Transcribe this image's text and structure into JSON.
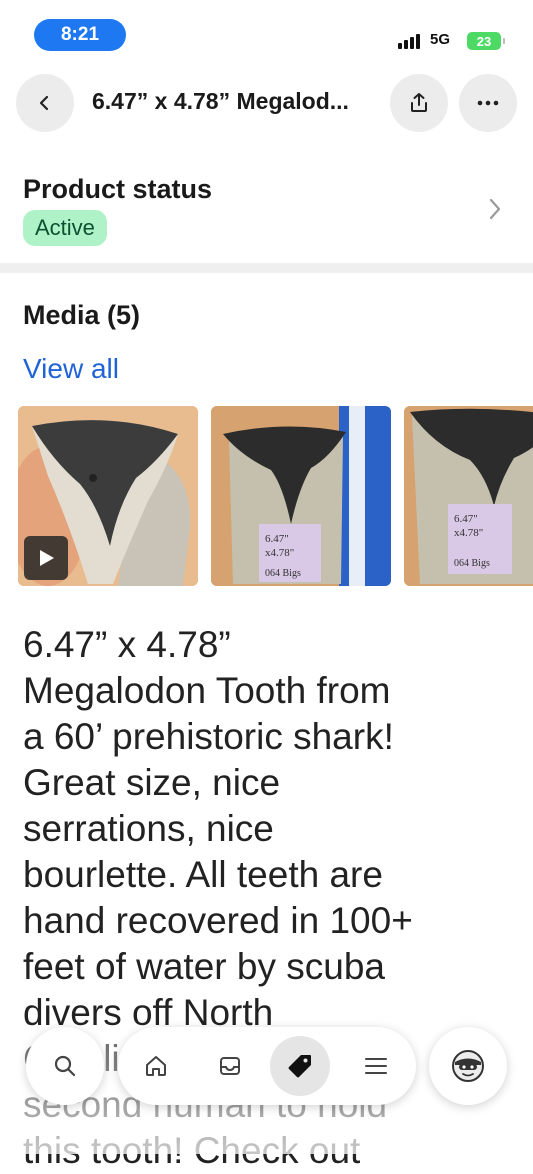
{
  "status_bar": {
    "time": "8:21",
    "network": "5G",
    "battery": "23"
  },
  "header": {
    "title": "6.47” x 4.78” Megalod..."
  },
  "product_status": {
    "heading": "Product status",
    "badge": "Active",
    "badge_color": "#aff2c7"
  },
  "media": {
    "heading": "Media (5)",
    "view_all": "View all"
  },
  "description": "6.47” x 4.78”\nMegalodon Tooth from\na 60’ prehistoric shark!\nGreat size, nice\nserrations, nice\nbourlette. All teeth are\nhand recovered in 100+\nfeet of water by scuba\ndivers off North\nCarolina. You’ll be the\nsecond human to hold\nthis tooth! Check out",
  "icons": {
    "back": "chevron-left-icon",
    "share": "share-icon",
    "more": "more-icon",
    "chevron": "chevron-right-icon",
    "search": "search-icon",
    "home": "home-icon",
    "orders": "inbox-icon",
    "products": "tag-icon",
    "menu": "menu-icon",
    "avatar": "avatar-icon"
  },
  "colors": {
    "link": "#1f63d6",
    "time_pill": "#1d78f2"
  }
}
